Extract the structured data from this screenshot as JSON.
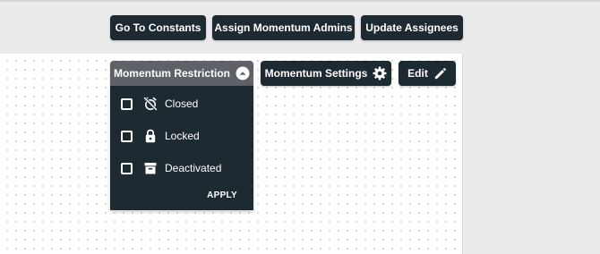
{
  "toolbar": {
    "go_to_constants": "Go To Constants",
    "assign_momentum_admins": "Assign Momentum Admins",
    "update_assignees": "Update Assignees"
  },
  "actions": {
    "momentum_restriction": "Momentum Restriction",
    "momentum_settings": "Momentum Settings",
    "edit": "Edit"
  },
  "restriction_menu": {
    "options": [
      {
        "label": "Closed",
        "icon": "closed-icon",
        "checked": false
      },
      {
        "label": "Locked",
        "icon": "lock-icon",
        "checked": false
      },
      {
        "label": "Deactivated",
        "icon": "archive-icon",
        "checked": false
      }
    ],
    "apply_label": "APPLY"
  },
  "colors": {
    "button_bg": "#1e2a32",
    "active_button_bg": "#5e6266",
    "page_bg": "#ebebeb",
    "canvas_bg": "#ffffff"
  }
}
